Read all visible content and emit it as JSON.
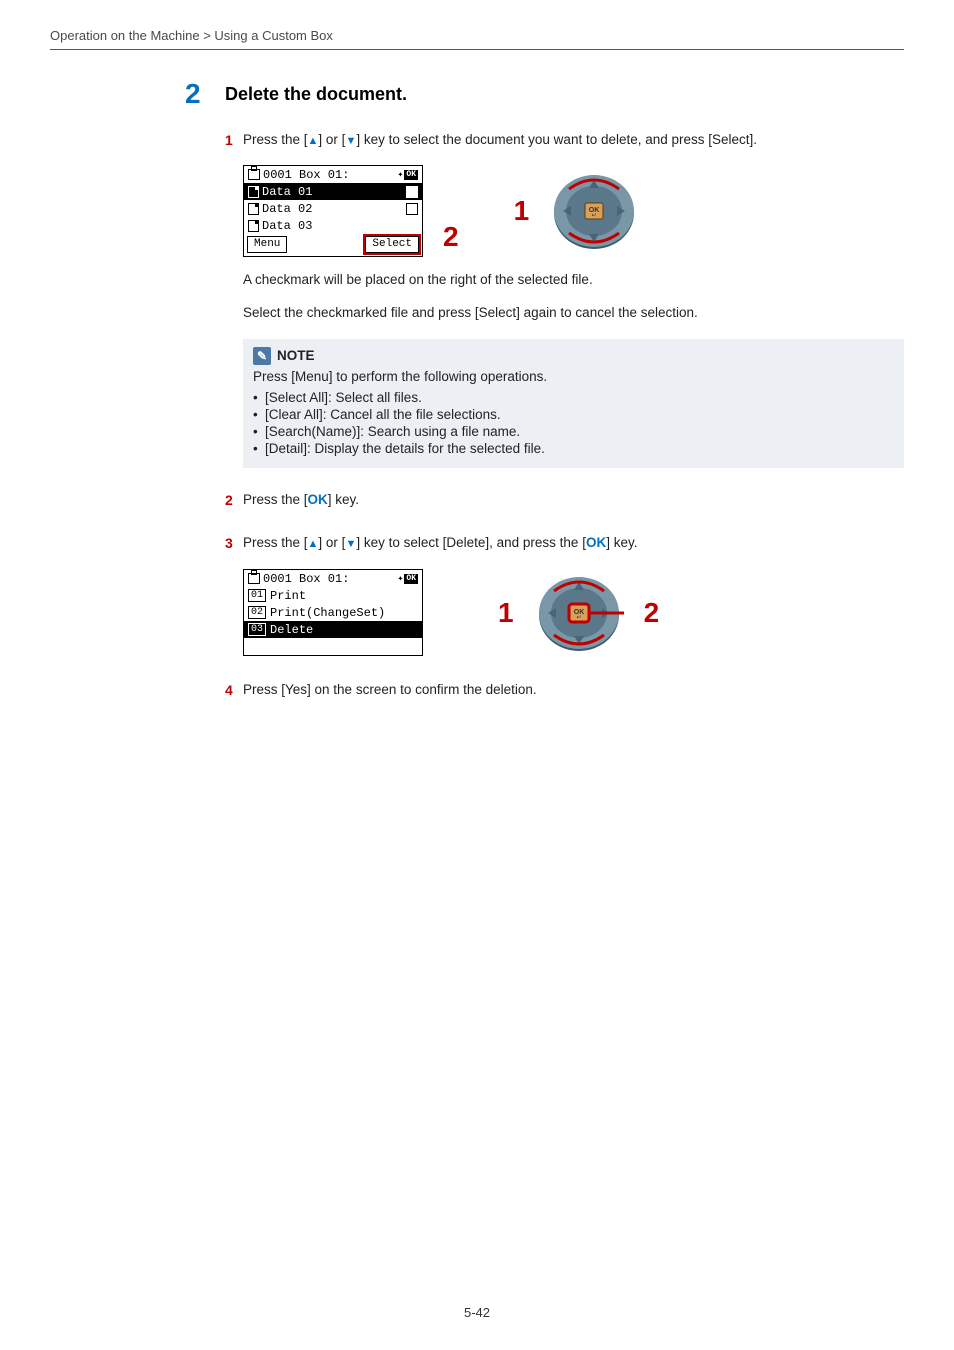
{
  "breadcrumb": "Operation on the Machine > Using a Custom Box",
  "big_step": {
    "num": "2",
    "title": "Delete the document."
  },
  "substeps": {
    "one": {
      "num": "1",
      "pre": "Press the [",
      "mid1": "] or [",
      "mid2": "] key to select the document you want to delete, and press [Select]."
    },
    "two": {
      "num": "2",
      "text_pre": "Press the [",
      "text_post": "] key.",
      "ok": "OK"
    },
    "three": {
      "num": "3",
      "pre": "Press the [",
      "mid1": "] or [",
      "mid2": "] key to select [Delete], and press the [",
      "ok": "OK",
      "post": "] key."
    },
    "four": {
      "num": "4",
      "text": "Press [Yes] on the screen to confirm the deletion."
    }
  },
  "lcd1": {
    "title": "0001 Box 01:",
    "rows": [
      {
        "label": "Data 01",
        "selected": true,
        "check": "checked"
      },
      {
        "label": "Data 02",
        "selected": false,
        "check": "empty"
      },
      {
        "label": "Data 03",
        "selected": false,
        "check": "none"
      }
    ],
    "soft_left": "Menu",
    "soft_right": "Select"
  },
  "lcd2": {
    "title": "0001 Box 01:",
    "rows": [
      {
        "num": "01",
        "label": "Print",
        "selected": false
      },
      {
        "num": "02",
        "label": "Print(ChangeSet)",
        "selected": false
      },
      {
        "num": "03",
        "label": "Delete",
        "selected": true
      }
    ]
  },
  "callouts": {
    "c1": "1",
    "c2": "2"
  },
  "para1": "A checkmark will be placed on the right of the selected file.",
  "para2": "Select the checkmarked file and press [Select] again to cancel the selection.",
  "note": {
    "title": "NOTE",
    "intro": "Press [Menu] to perform the following operations.",
    "bullets": [
      "[Select All]: Select all files.",
      "[Clear All]: Cancel all the file selections.",
      "[Search(Name)]: Search using a file name.",
      "[Detail]: Display the details for the selected file."
    ]
  },
  "footer": "5-42"
}
